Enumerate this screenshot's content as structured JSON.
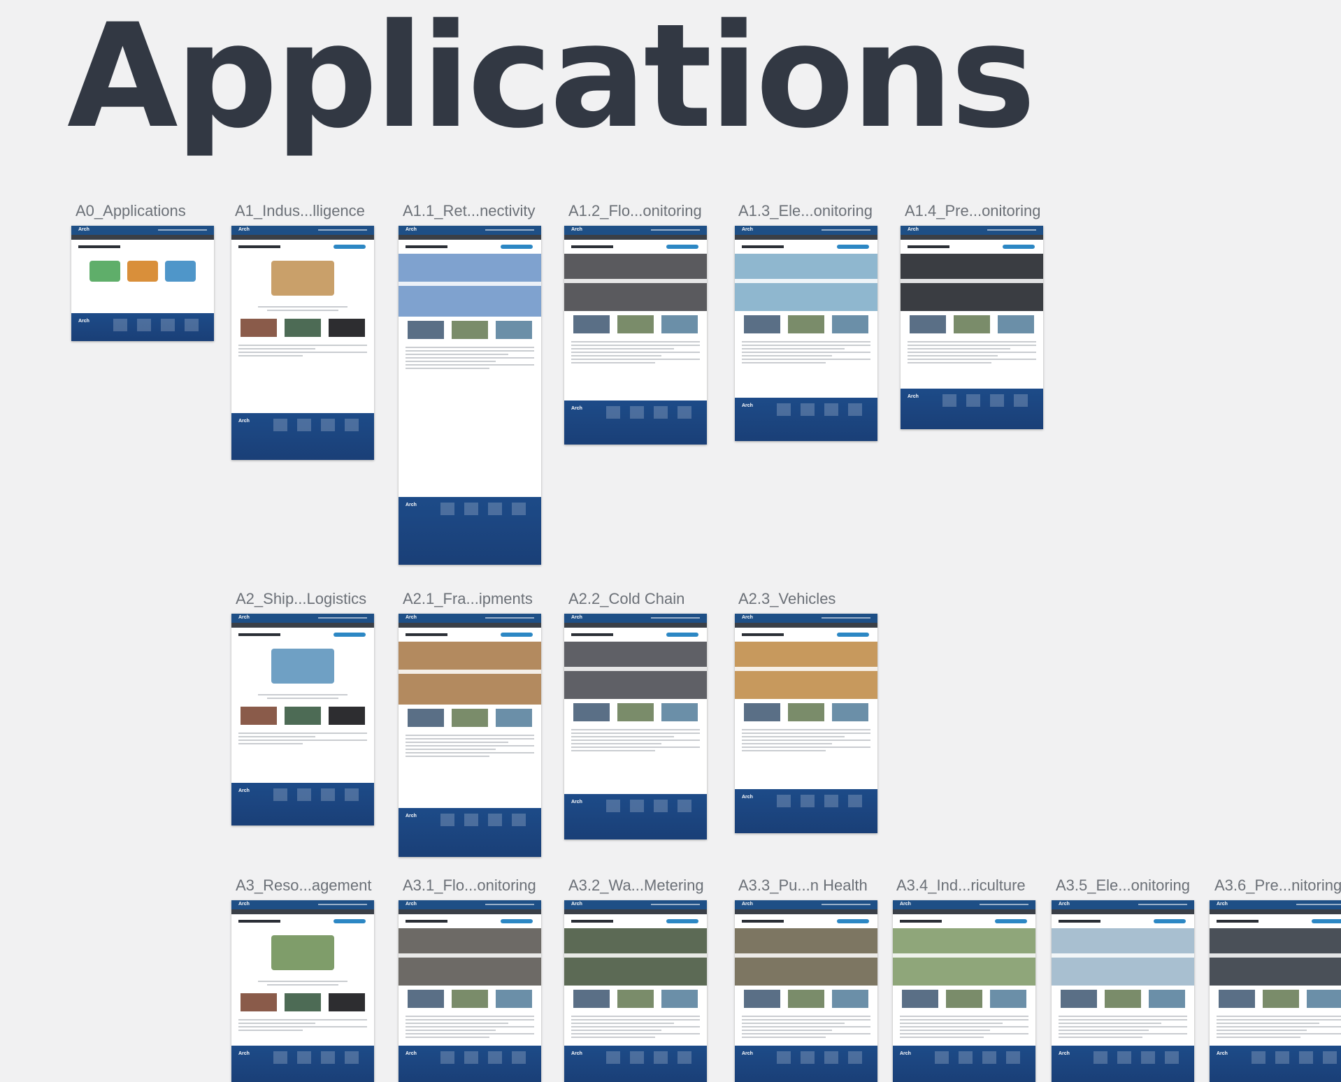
{
  "title": "Applications",
  "artboards": [
    {
      "label": "A0_Applications",
      "kind": "overview"
    },
    {
      "label": "A1_Indus...lligence",
      "kind": "category",
      "hero": "#c9a06a"
    },
    {
      "label": "A1.1_Ret...nectivity",
      "kind": "long",
      "hero": "#7fa2cf"
    },
    {
      "label": "A1.2_Flo...onitoring",
      "kind": "detail",
      "hero": "#5a5a5e"
    },
    {
      "label": "A1.3_Ele...onitoring",
      "kind": "detail",
      "hero": "#8fb7cf"
    },
    {
      "label": "A1.4_Pre...onitoring",
      "kind": "detail",
      "hero": "#3a3d42"
    },
    {
      "label": "A2_Ship...Logistics",
      "kind": "category",
      "hero": "#6fa0c4"
    },
    {
      "label": "A2.1_Fra...ipments",
      "kind": "long",
      "hero": "#b38a5f"
    },
    {
      "label": "A2.2_Cold Chain",
      "kind": "detail",
      "hero": "#5f6066"
    },
    {
      "label": "A2.3_Vehicles",
      "kind": "detail",
      "hero": "#c7995d"
    },
    {
      "label": "A3_Reso...agement",
      "kind": "category",
      "hero": "#7f9d6a"
    },
    {
      "label": "A3.1_Flo...onitoring",
      "kind": "detail",
      "hero": "#6d6a66"
    },
    {
      "label": "A3.2_Wa...Metering",
      "kind": "detail",
      "hero": "#5c6a55"
    },
    {
      "label": "A3.3_Pu...n Health",
      "kind": "detail",
      "hero": "#7d7662"
    },
    {
      "label": "A3.4_Ind...riculture",
      "kind": "detail",
      "hero": "#8fa67a"
    },
    {
      "label": "A3.5_Ele...onitoring",
      "kind": "detail",
      "hero": "#a8bfd0"
    },
    {
      "label": "A3.6_Pre...nitoring",
      "kind": "detail",
      "hero": "#4a5058"
    }
  ],
  "colors": {
    "background": "#f1f1f2",
    "title": "#323843",
    "label": "#6b7077",
    "brand_blue": "#1e4f86",
    "button_blue": "#2c87c4"
  },
  "thumbnail_logo": "Arch"
}
